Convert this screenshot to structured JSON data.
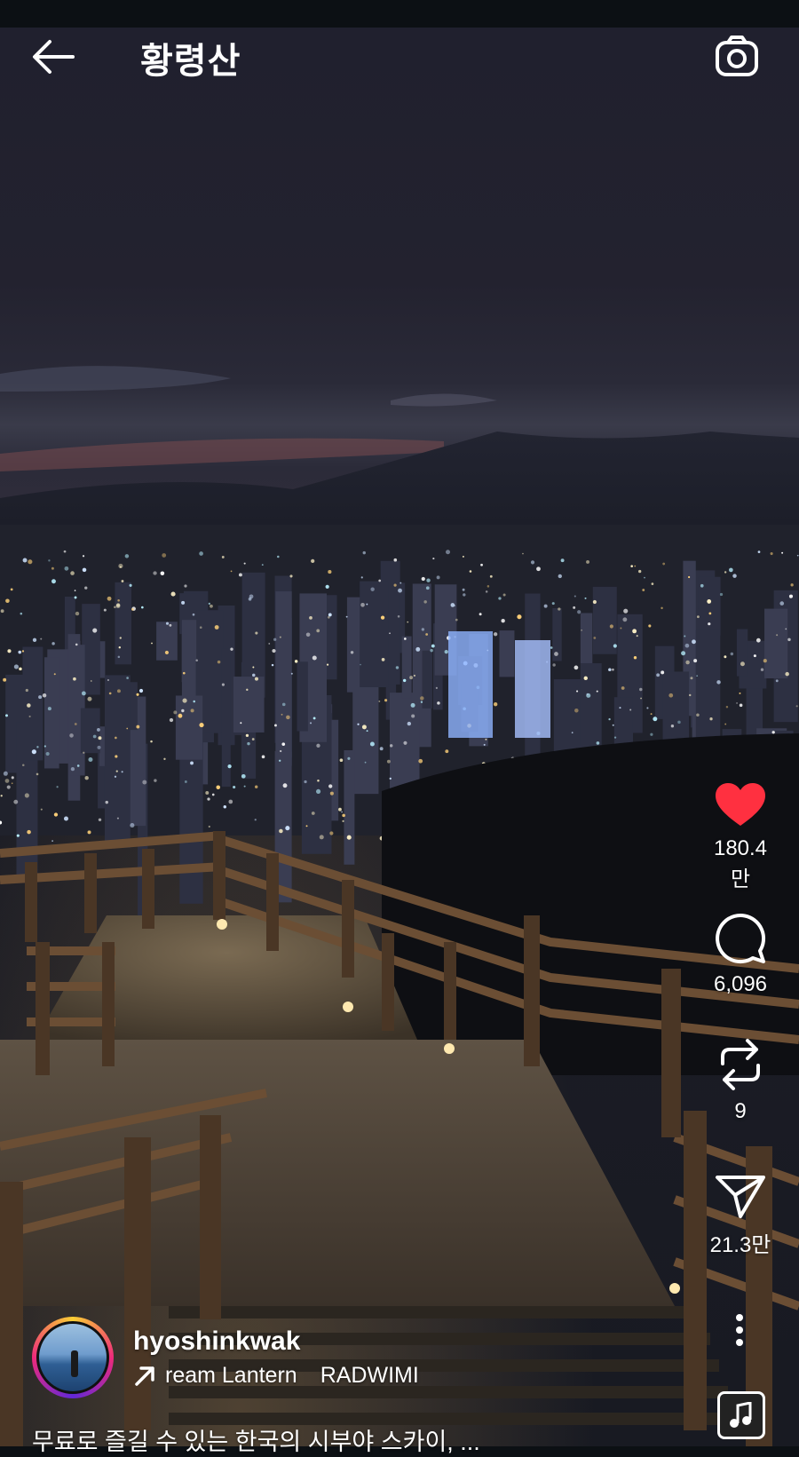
{
  "header": {
    "title": "황령산",
    "back_icon": "arrow-left-icon",
    "camera_icon": "camera-icon"
  },
  "actions": {
    "like": {
      "icon": "heart-icon",
      "count": "180.4만",
      "liked": true,
      "color": "#ff3040"
    },
    "comment": {
      "icon": "comment-icon",
      "count": "6,096"
    },
    "repost": {
      "icon": "repost-icon",
      "count": "9"
    },
    "share": {
      "icon": "send-icon",
      "count": "21.3만"
    },
    "more_icon": "more-vertical-icon",
    "music_icon": "music-note-icon"
  },
  "post": {
    "username": "hyoshinkwak",
    "music": {
      "song": "ream Lantern",
      "artist": "RADWIMI"
    },
    "caption": "무료로 즐길 수 있는 한국의 시부야 스카이, ..."
  },
  "colors": {
    "background": "#0c1014",
    "text": "#ffffff",
    "like": "#ff3040"
  }
}
